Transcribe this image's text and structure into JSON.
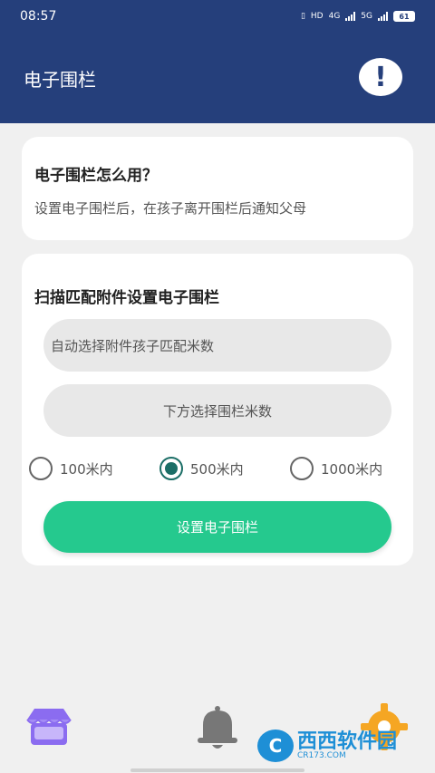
{
  "status_bar": {
    "time": "08:57",
    "hd_label": "HD",
    "net1": "4G",
    "net2": "5G",
    "battery": "61"
  },
  "header": {
    "title": "电子围栏",
    "info_symbol": "!"
  },
  "usage_card": {
    "title": "电子围栏怎么用？",
    "description": "设置电子围栏后，在孩子离开围栏后通知父母"
  },
  "fence_card": {
    "title": "扫描匹配附件设置电子围栏",
    "auto_select_placeholder": "自动选择附件孩子匹配米数",
    "manual_select_placeholder": "下方选择围栏米数",
    "radio_options": [
      {
        "label": "100米内",
        "checked": false
      },
      {
        "label": "500米内",
        "checked": true
      },
      {
        "label": "1000米内",
        "checked": false
      }
    ],
    "submit_label": "设置电子围栏"
  },
  "bottom_nav": {
    "items": [
      {
        "icon": "shop-icon"
      },
      {
        "icon": "bell-icon"
      },
      {
        "icon": "gear-icon"
      }
    ]
  },
  "watermark": {
    "main": "西西软件园",
    "sub": "CR173.COM"
  },
  "colors": {
    "header_bg": "#253f7b",
    "accent_green": "#25c98e",
    "radio_checked": "#1b6e66",
    "shop_purple": "#8b6cf0",
    "bell_gray": "#777777",
    "gear_orange": "#f5a623"
  }
}
